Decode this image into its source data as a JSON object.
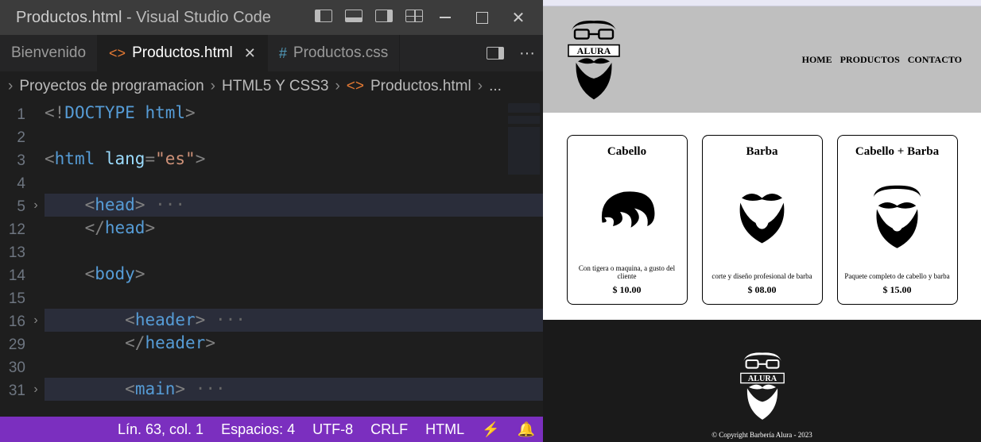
{
  "titlebar": {
    "filename": "Productos.html",
    "app": "Visual Studio Code"
  },
  "tabs": {
    "welcome": "Bienvenido",
    "active": "Productos.html",
    "css": "Productos.css"
  },
  "breadcrumbs": {
    "a": "Proyectos de programacion",
    "b": "HTML5 Y CSS3",
    "c": "Productos.html",
    "d": "..."
  },
  "gutter": [
    "1",
    "2",
    "3",
    "4",
    "5",
    "12",
    "13",
    "14",
    "15",
    "16",
    "29",
    "30",
    "31"
  ],
  "code": {
    "l1a": "<!",
    "l1b": "DOCTYPE ",
    "l1c": "html",
    "l1d": ">",
    "l3a": "<",
    "l3b": "html ",
    "l3c": "lang",
    "l3d": "=",
    "l3e": "\"es\"",
    "l3f": ">",
    "l5a": "<",
    "l5b": "head",
    "l5c": ">",
    "l5d": " ···",
    "l12a": "</",
    "l12b": "head",
    "l12c": ">",
    "l14a": "<",
    "l14b": "body",
    "l14c": ">",
    "l16a": "<",
    "l16b": "header",
    "l16c": ">",
    "l16d": " ···",
    "l29a": "</",
    "l29b": "header",
    "l29c": ">",
    "l31a": "<",
    "l31b": "main",
    "l31c": ">",
    "l31d": " ···"
  },
  "status": {
    "pos": "Lín. 63, col. 1",
    "spaces": "Espacios: 4",
    "enc": "UTF-8",
    "eol": "CRLF",
    "lang": "HTML"
  },
  "logo_text": "ALURA",
  "nav": {
    "a": "HOME",
    "b": "PRODUCTOS",
    "c": "CONTACTO"
  },
  "cards": [
    {
      "title": "Cabello",
      "desc": "Con tigera o maquina, a gusto del cliente",
      "price": "$ 10.00"
    },
    {
      "title": "Barba",
      "desc": "corte y diseño profesional de barba",
      "price": "$ 08.00"
    },
    {
      "title": "Cabello + Barba",
      "desc": "Paquete completo de cabello y barba",
      "price": "$ 15.00"
    }
  ],
  "footer": {
    "copy": "© Copyright Barbería Alura - 2023"
  }
}
